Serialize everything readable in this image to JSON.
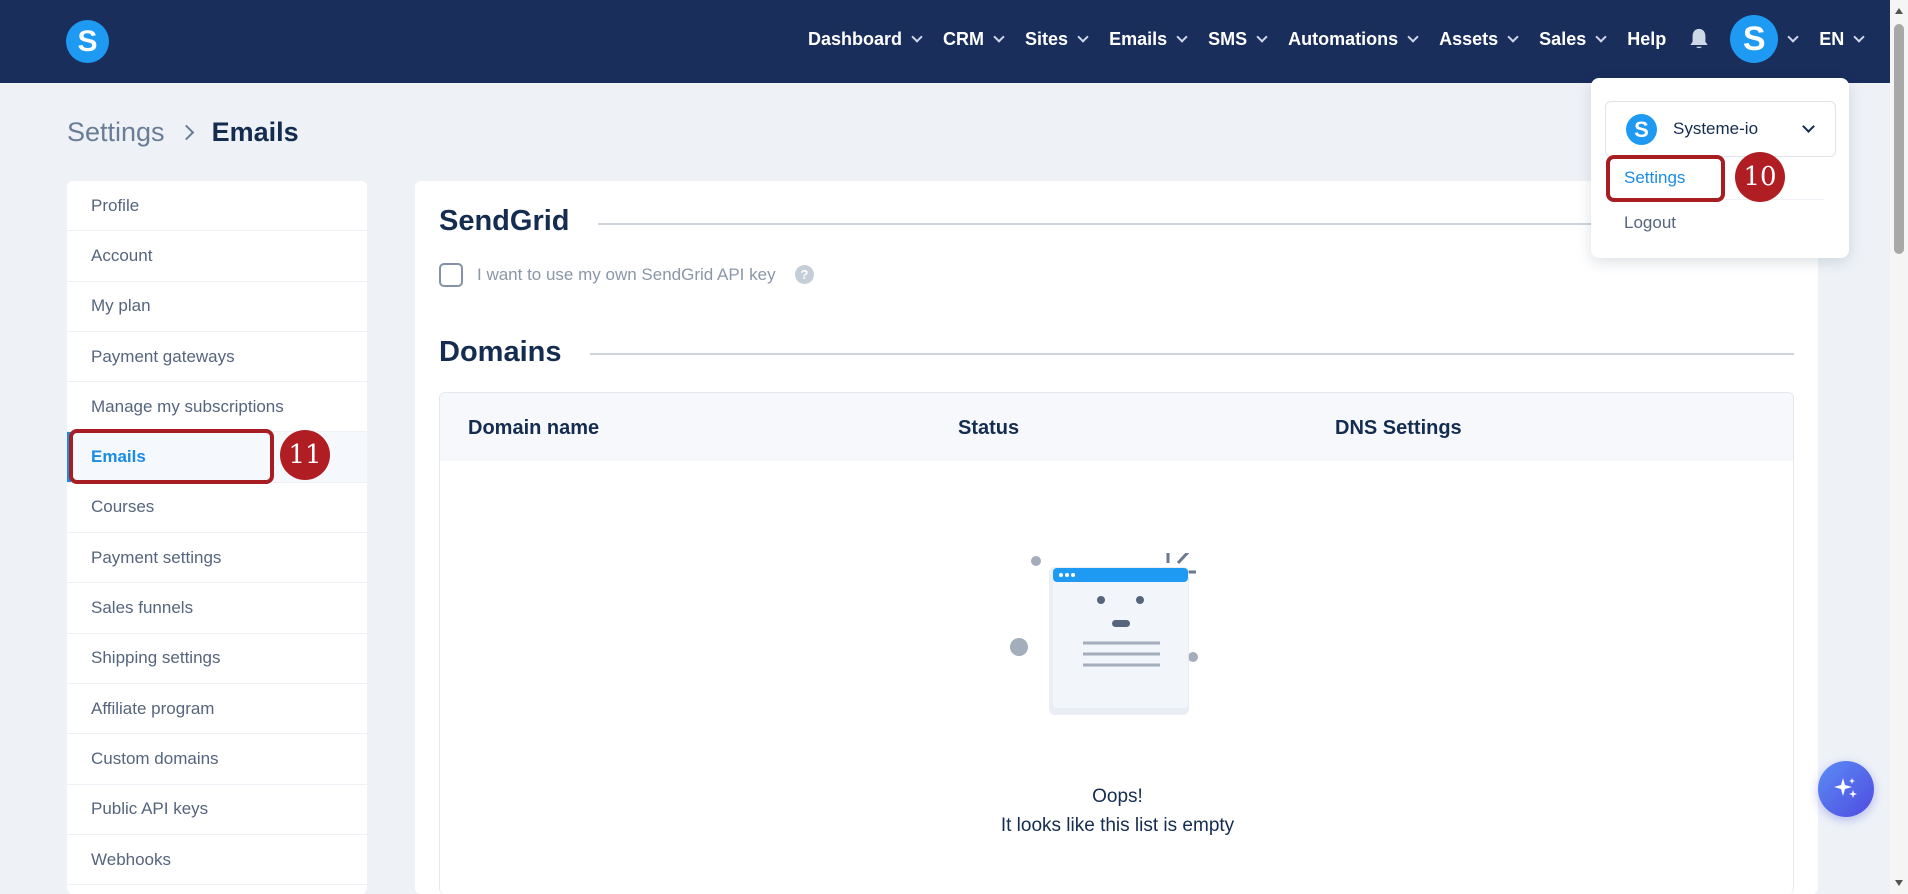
{
  "app": {
    "logo_letter": "S"
  },
  "nav": {
    "items": [
      "Dashboard",
      "CRM",
      "Sites",
      "Emails",
      "SMS",
      "Automations",
      "Assets",
      "Sales",
      "Help"
    ],
    "avatar_letter": "S",
    "language": "EN"
  },
  "breadcrumb": {
    "parent": "Settings",
    "current": "Emails"
  },
  "sidebar": {
    "items": [
      "Profile",
      "Account",
      "My plan",
      "Payment gateways",
      "Manage my subscriptions",
      "Emails",
      "Courses",
      "Payment settings",
      "Sales funnels",
      "Shipping settings",
      "Affiliate program",
      "Custom domains",
      "Public API keys",
      "Webhooks"
    ],
    "active": "Emails"
  },
  "main": {
    "sendgrid_title": "SendGrid",
    "sendgrid_checkbox_label": "I want to use my own SendGrid API key",
    "help_glyph": "?",
    "domains_title": "Domains",
    "table_headers": [
      "Domain name",
      "Status",
      "DNS Settings"
    ],
    "empty_title": "Oops!",
    "empty_subtitle": "It looks like this list is empty"
  },
  "dropdown": {
    "account_logo_letter": "S",
    "account_name": "Systeme-io",
    "settings_label": "Settings",
    "logout_label": "Logout"
  },
  "annotations": {
    "step_10": "10",
    "step_11": "11"
  },
  "colors": {
    "nav_bg": "#1a2e5c",
    "brand_blue": "#1e9af3",
    "accent_link": "#1a8ce6",
    "annotation_red": "#a81d22",
    "page_bg": "#eef2f7"
  },
  "icons": {
    "bell": "bell-icon",
    "chevron": "chevron-down-icon",
    "help": "help-icon",
    "fab": "sparkle-icon"
  }
}
